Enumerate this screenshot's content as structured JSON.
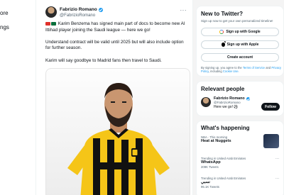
{
  "nav": {
    "items": [
      "ore",
      "ngs"
    ]
  },
  "tweet": {
    "author_name": "Fabrizio Romano",
    "author_handle": "@FabrizioRomano",
    "paragraph1": "Karim Benzema has signed main part of docs to become new Al Ittihad player joining the Saudi league — here we go!",
    "paragraph2": "Understand contract will be valid until 2025 but will also include option for further season.",
    "paragraph3": "Karim will say goodbye to Madrid fans then travel to Saudi.",
    "image_icon": "player-photo"
  },
  "sidebar": {
    "signup": {
      "title": "New to Twitter?",
      "subtitle": "Sign up now to get your own personalized timeline!",
      "google_label": "Sign up with Google",
      "apple_label": "Sign up with Apple",
      "create_label": "Create account",
      "legal_prefix": "By signing up, you agree to the",
      "terms": "Terms of Service",
      "and": "and",
      "privacy": "Privacy Policy",
      "including": ", including",
      "cookie": "Cookie Use."
    },
    "relevant": {
      "title": "Relevant people",
      "name": "Fabrizio Romano",
      "handle": "@FabrizioRomano",
      "bio": "Here we go! ⚽",
      "follow_label": "Follow"
    },
    "happening": {
      "title": "What's happening",
      "trends": [
        {
          "context": "NBA · This morning",
          "name": "Heat at Nuggets",
          "count": ""
        },
        {
          "context": "Trending in United Arab Emirates",
          "name": "WhatsApp",
          "count": "209K Tweets"
        },
        {
          "context": "Trending in United Arab Emirates",
          "name": "نسبي",
          "count": "95.1K Tweets"
        }
      ]
    }
  },
  "colors": {
    "accent": "#1d9bf0",
    "jersey_yellow": "#f5c518",
    "jersey_black": "#111111"
  }
}
